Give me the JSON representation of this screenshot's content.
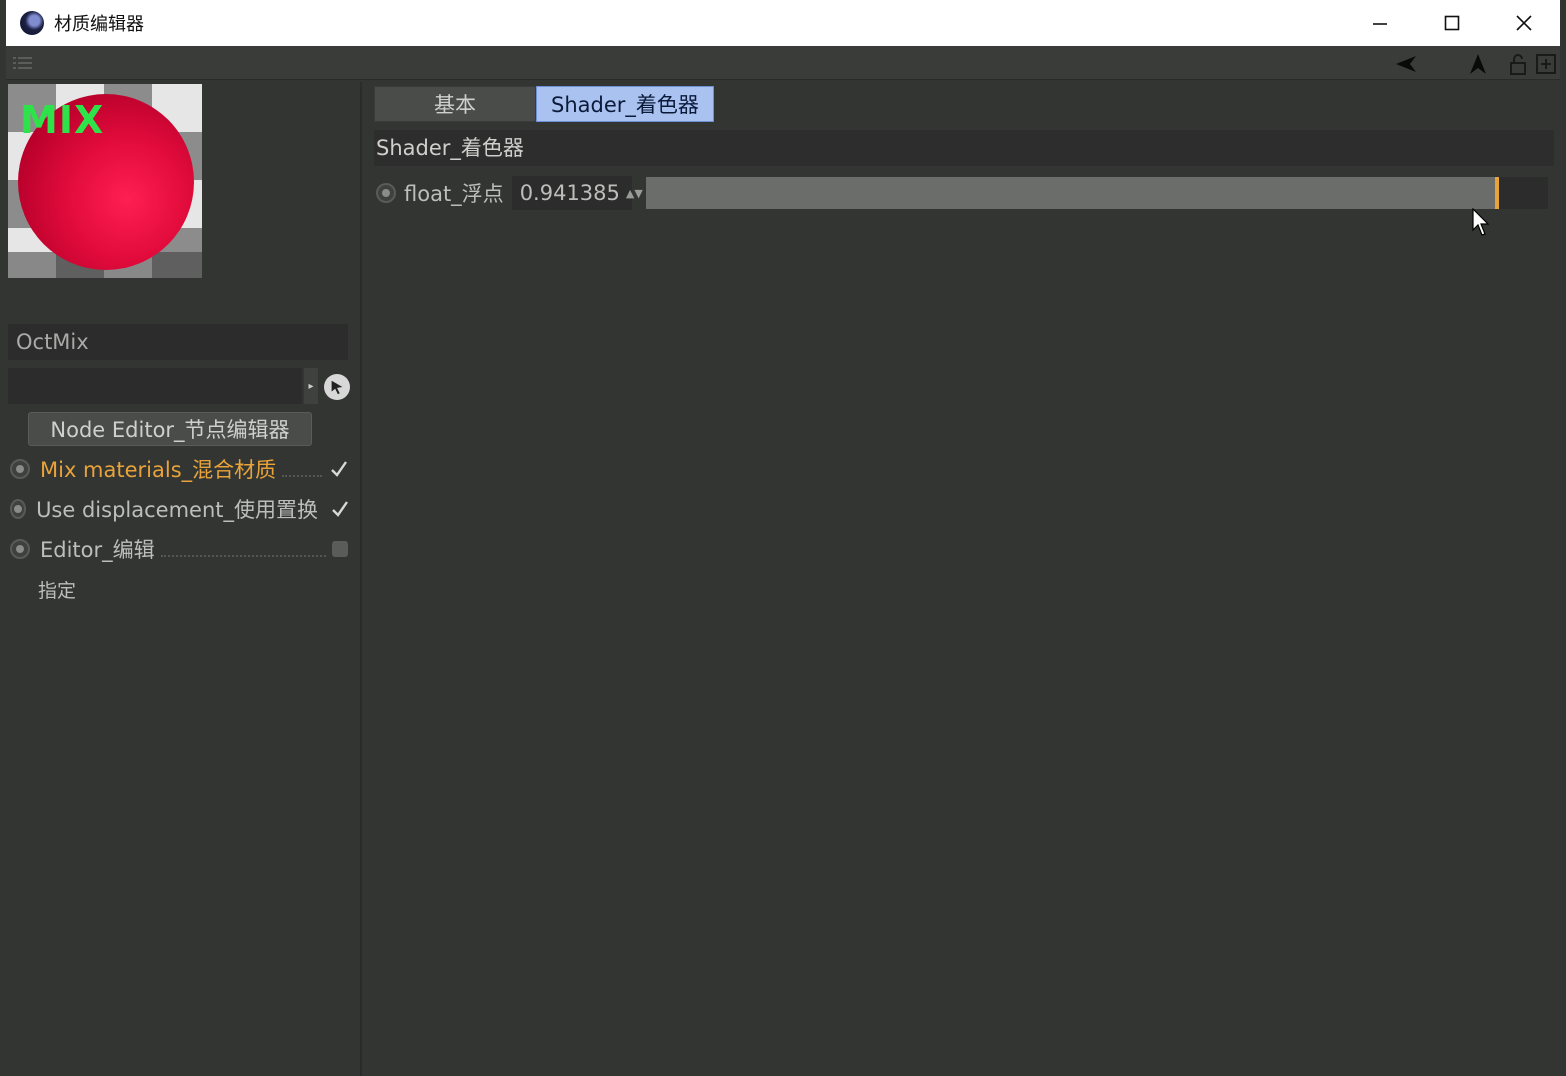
{
  "window": {
    "title": "材质编辑器"
  },
  "preview": {
    "badge": "MIX"
  },
  "material": {
    "name": "OctMix",
    "node_editor_label": "Node Editor_节点编辑器"
  },
  "options": [
    {
      "label": "Mix materials_混合材质",
      "state": "checked",
      "active": true
    },
    {
      "label": "Use displacement_使用置换",
      "state": "checked",
      "active": false
    },
    {
      "label": "Editor_编辑",
      "state": "unchecked",
      "active": false
    }
  ],
  "assign_label": "指定",
  "tabs": [
    {
      "label": "基本",
      "active": false
    },
    {
      "label": "Shader_着色器",
      "active": true
    }
  ],
  "section": {
    "title": "Shader_着色器"
  },
  "param": {
    "label": "float_浮点",
    "value": "0.941385",
    "slider_fraction": 0.941385
  },
  "colors": {
    "accent_active": "#e8a33a",
    "tab_active_bg": "#a9c2ef",
    "sphere_red": "#e10b3b",
    "mix_green": "#2ee24a"
  },
  "icons": {
    "toolbar": [
      "back-arrow-icon",
      "up-arrow-icon",
      "lock-icon",
      "new-window-icon"
    ],
    "window": [
      "minimize-icon",
      "maximize-icon",
      "close-icon"
    ]
  }
}
